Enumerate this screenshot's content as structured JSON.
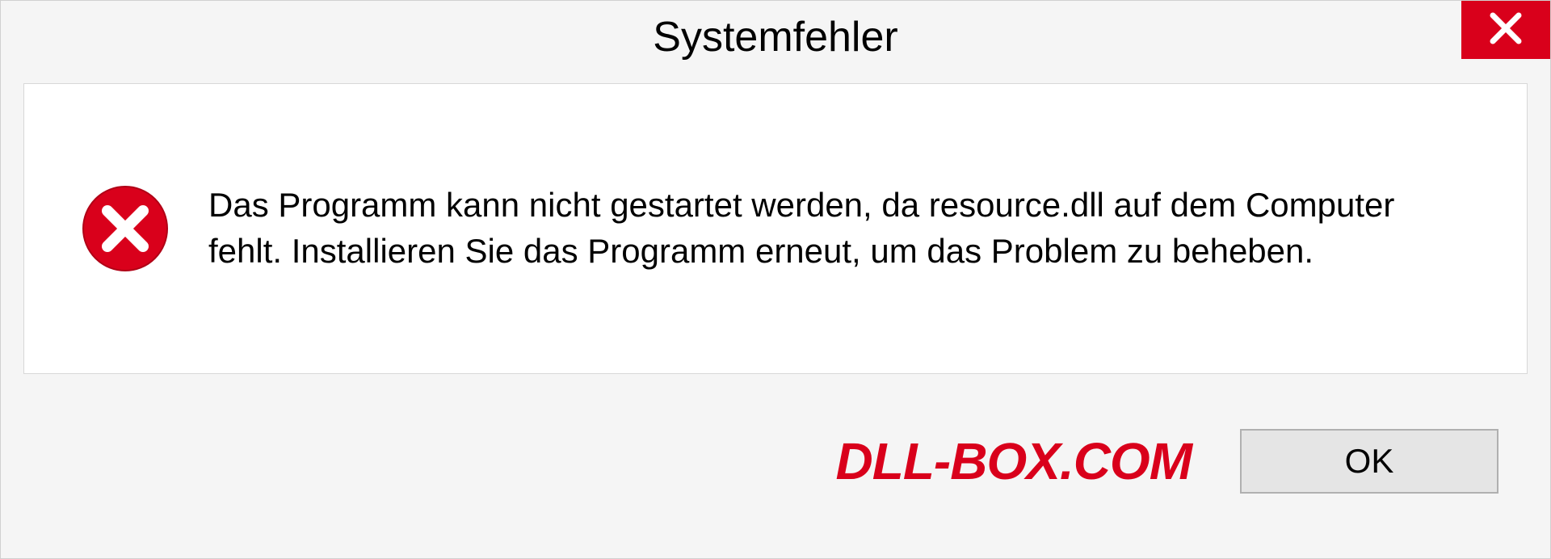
{
  "dialog": {
    "title": "Systemfehler",
    "message": "Das Programm kann nicht gestartet werden, da resource.dll auf dem Computer fehlt. Installieren Sie das Programm erneut, um das Problem zu beheben.",
    "ok_label": "OK",
    "watermark": "DLL-BOX.COM"
  },
  "colors": {
    "error_red": "#d9001b",
    "background": "#f5f5f5",
    "content_bg": "#ffffff",
    "button_bg": "#e5e5e5"
  }
}
